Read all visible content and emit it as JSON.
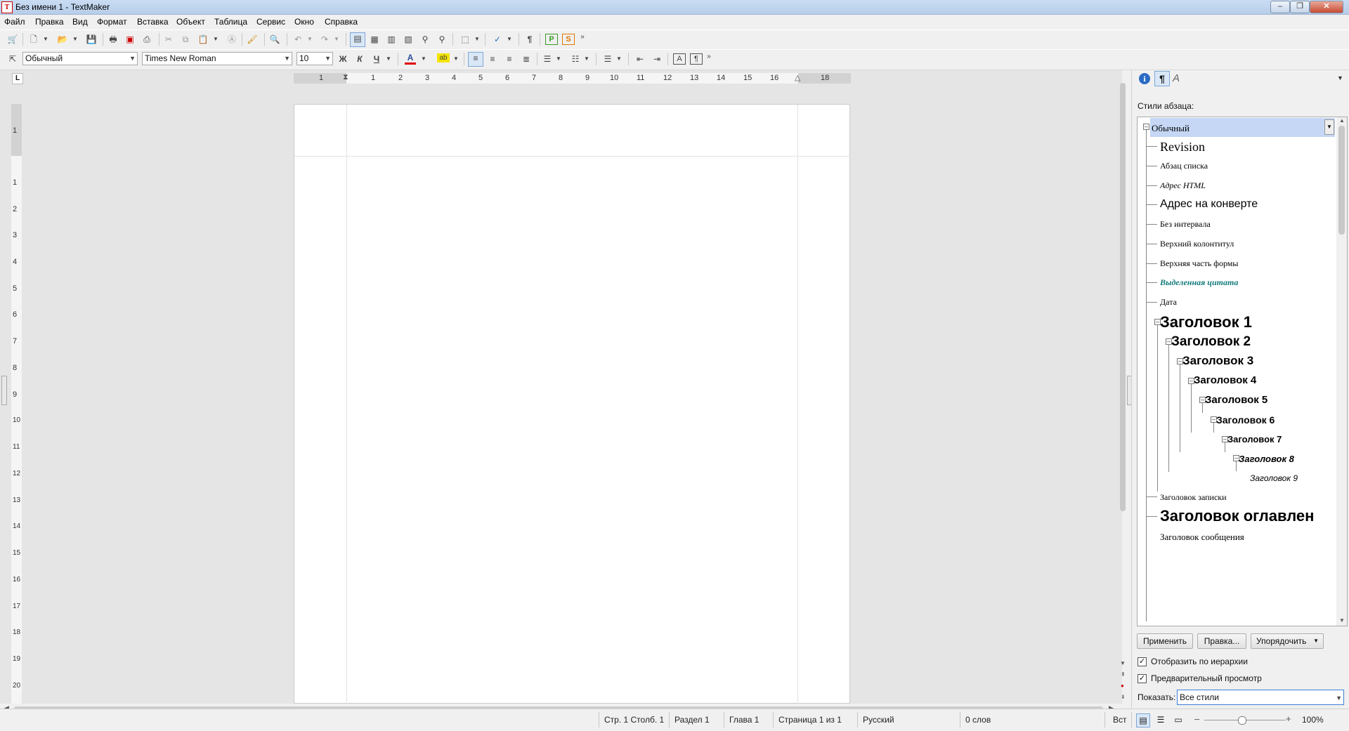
{
  "window": {
    "title": "Без имени 1 - TextMaker"
  },
  "menu": [
    "Файл",
    "Правка",
    "Вид",
    "Формат",
    "Вставка",
    "Объект",
    "Таблица",
    "Сервис",
    "Окно",
    "Справка"
  ],
  "format_bar": {
    "style_value": "Обычный",
    "font_value": "Times New Roman",
    "size_value": "10",
    "bold": "Ж",
    "italic": "К",
    "underline": "Ч",
    "font_color_letter": "A",
    "highlight_text": "ab"
  },
  "colors": {
    "accent": "#3c7fd8",
    "title_bar": "#c9dcf2",
    "selected_style": "#c5d7f5",
    "highlight": "#f5e400",
    "font_color": "#e00000",
    "teal_style": "#137a7a"
  },
  "ruler": {
    "h_numbers": [
      "1",
      "1",
      "2",
      "3",
      "4",
      "5",
      "6",
      "7",
      "8",
      "9",
      "10",
      "11",
      "12",
      "13",
      "14",
      "15",
      "16",
      "18"
    ],
    "v_numbers": [
      "1",
      "1",
      "2",
      "3",
      "4",
      "5",
      "6",
      "7",
      "8",
      "9",
      "10",
      "11",
      "12",
      "13",
      "14",
      "15",
      "16",
      "17",
      "18",
      "19",
      "20"
    ]
  },
  "sidebar": {
    "styles_label": "Стили абзаца:",
    "styles": [
      "Обычный",
      "Revision",
      "Абзац списка",
      "Адрес HTML",
      "Адрес на конверте",
      "Без интервала",
      "Верхний колонтитул",
      "Верхняя часть формы",
      "Выделенная цитата",
      "Дата",
      "Заголовок 1",
      "Заголовок 2",
      "Заголовок 3",
      "Заголовок 4",
      "Заголовок 5",
      "Заголовок 6",
      "Заголовок 7",
      "Заголовок 8",
      "Заголовок 9",
      "Заголовок записки",
      "Заголовок оглавлен",
      "Заголовок сообщения"
    ],
    "apply_button": "Применить",
    "edit_button": "Правка...",
    "sort_button": "Упорядочить",
    "show_hierarchy": "Отобразить по иерархии",
    "preview": "Предварительный просмотр",
    "show_label": "Показать:",
    "show_value": "Все стили"
  },
  "status": {
    "position": "Стр. 1 Столб. 1",
    "section": "Раздел 1",
    "chapter": "Глава 1",
    "page": "Страница 1 из 1",
    "language": "Русский",
    "words": "0 слов",
    "mode": "Вст",
    "zoom": "100%"
  }
}
